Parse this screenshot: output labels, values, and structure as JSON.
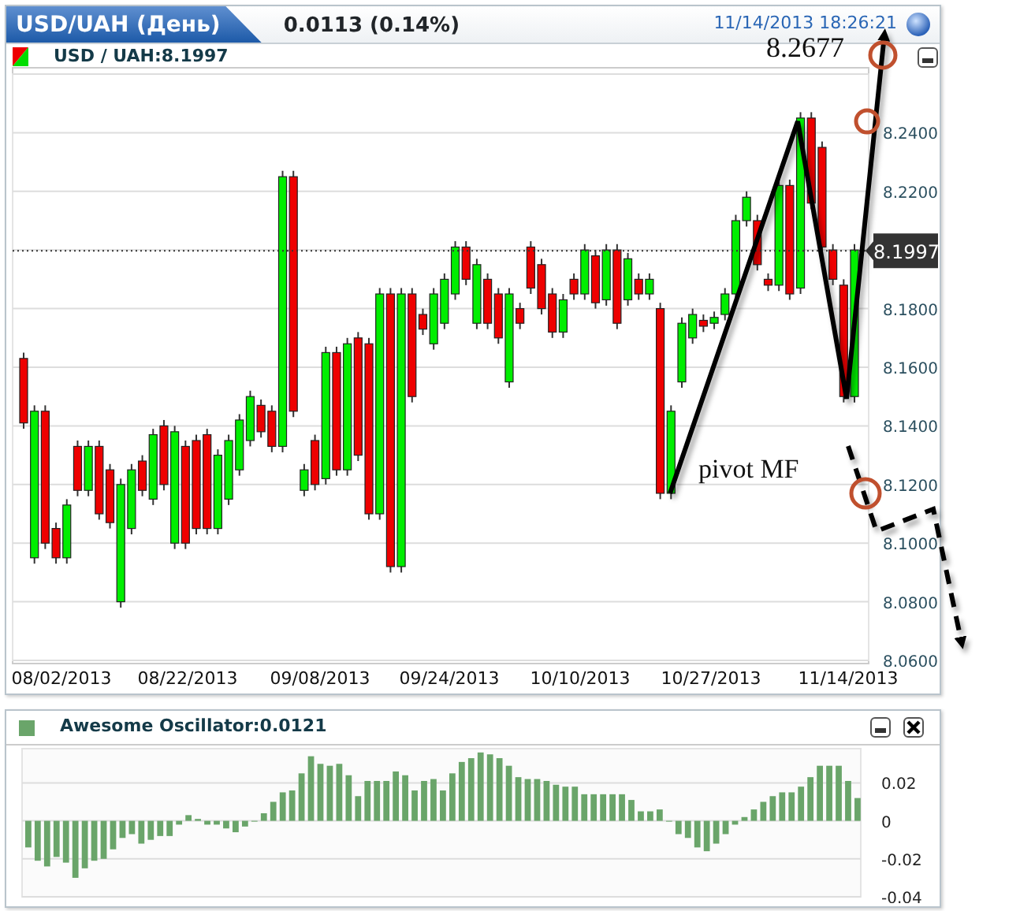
{
  "header": {
    "title": "USD/UAH (День)",
    "change": "0.0113 (0.14%)",
    "timestamp": "11/14/2013 18:26:21"
  },
  "main_chart": {
    "legend": "USD / UAH:8.1997",
    "x_axis_labels": [
      "08/02/2013",
      "08/22/2013",
      "09/08/2013",
      "09/24/2013",
      "10/10/2013",
      "10/27/2013",
      "11/14/2013"
    ],
    "chart_data": {
      "type": "candlestick",
      "ylim": [
        8.06,
        8.26
      ],
      "grid": true,
      "ref_lines": [
        {
          "axis": "y",
          "value": 8.1997,
          "label": "8.1997"
        }
      ],
      "yticks": [
        {
          "value": 8.24,
          "label": "8.2400"
        },
        {
          "value": 8.22,
          "label": "8.2200"
        },
        {
          "value": 8.18,
          "label": "8.1800"
        },
        {
          "value": 8.16,
          "label": "8.1600"
        },
        {
          "value": 8.14,
          "label": "8.1400"
        },
        {
          "value": 8.12,
          "label": "8.1200"
        },
        {
          "value": 8.1,
          "label": "8.1000"
        },
        {
          "value": 8.08,
          "label": "8.0800"
        },
        {
          "value": 8.06,
          "label": "8.0600"
        }
      ],
      "ohlc": [
        [
          8.163,
          8.165,
          8.139,
          8.141
        ],
        [
          8.095,
          8.147,
          8.093,
          8.145
        ],
        [
          8.145,
          8.147,
          8.098,
          8.1
        ],
        [
          8.105,
          8.107,
          8.093,
          8.095
        ],
        [
          8.095,
          8.115,
          8.093,
          8.113
        ],
        [
          8.133,
          8.135,
          8.116,
          8.118
        ],
        [
          8.118,
          8.135,
          8.116,
          8.133
        ],
        [
          8.133,
          8.135,
          8.108,
          8.11
        ],
        [
          8.125,
          8.127,
          8.105,
          8.107
        ],
        [
          8.08,
          8.122,
          8.078,
          8.12
        ],
        [
          8.105,
          8.127,
          8.103,
          8.125
        ],
        [
          8.128,
          8.13,
          8.116,
          8.118
        ],
        [
          8.115,
          8.139,
          8.113,
          8.137
        ],
        [
          8.14,
          8.142,
          8.118,
          8.12
        ],
        [
          8.1,
          8.14,
          8.098,
          8.138
        ],
        [
          8.133,
          8.135,
          8.098,
          8.1
        ],
        [
          8.135,
          8.137,
          8.103,
          8.105
        ],
        [
          8.137,
          8.139,
          8.103,
          8.105
        ],
        [
          8.105,
          8.132,
          8.103,
          8.13
        ],
        [
          8.115,
          8.137,
          8.113,
          8.135
        ],
        [
          8.125,
          8.144,
          8.123,
          8.142
        ],
        [
          8.135,
          8.152,
          8.133,
          8.15
        ],
        [
          8.147,
          8.149,
          8.136,
          8.138
        ],
        [
          8.145,
          8.147,
          8.131,
          8.133
        ],
        [
          8.133,
          8.227,
          8.131,
          8.225
        ],
        [
          8.225,
          8.227,
          8.143,
          8.145
        ],
        [
          8.118,
          8.127,
          8.116,
          8.125
        ],
        [
          8.135,
          8.137,
          8.118,
          8.12
        ],
        [
          8.122,
          8.167,
          8.12,
          8.165
        ],
        [
          8.165,
          8.167,
          8.123,
          8.125
        ],
        [
          8.125,
          8.17,
          8.123,
          8.168
        ],
        [
          8.17,
          8.172,
          8.128,
          8.13
        ],
        [
          8.168,
          8.17,
          8.108,
          8.11
        ],
        [
          8.11,
          8.187,
          8.108,
          8.185
        ],
        [
          8.185,
          8.187,
          8.09,
          8.092
        ],
        [
          8.092,
          8.187,
          8.09,
          8.185
        ],
        [
          8.185,
          8.187,
          8.148,
          8.15
        ],
        [
          8.178,
          8.18,
          8.171,
          8.173
        ],
        [
          8.168,
          8.187,
          8.166,
          8.185
        ],
        [
          8.175,
          8.192,
          8.173,
          8.19
        ],
        [
          8.185,
          8.203,
          8.183,
          8.201
        ],
        [
          8.201,
          8.203,
          8.188,
          8.19
        ],
        [
          8.175,
          8.197,
          8.173,
          8.195
        ],
        [
          8.19,
          8.192,
          8.173,
          8.175
        ],
        [
          8.185,
          8.187,
          8.168,
          8.17
        ],
        [
          8.155,
          8.187,
          8.153,
          8.185
        ],
        [
          8.18,
          8.182,
          8.173,
          8.175
        ],
        [
          8.201,
          8.203,
          8.185,
          8.187
        ],
        [
          8.195,
          8.197,
          8.178,
          8.18
        ],
        [
          8.185,
          8.187,
          8.17,
          8.172
        ],
        [
          8.172,
          8.185,
          8.17,
          8.183
        ],
        [
          8.19,
          8.192,
          8.183,
          8.185
        ],
        [
          8.185,
          8.202,
          8.183,
          8.2
        ],
        [
          8.198,
          8.2,
          8.18,
          8.182
        ],
        [
          8.183,
          8.202,
          8.181,
          8.2
        ],
        [
          8.2,
          8.202,
          8.173,
          8.175
        ],
        [
          8.183,
          8.199,
          8.181,
          8.197
        ],
        [
          8.19,
          8.192,
          8.183,
          8.185
        ],
        [
          8.185,
          8.192,
          8.183,
          8.19
        ],
        [
          8.18,
          8.182,
          8.115,
          8.117
        ],
        [
          8.117,
          8.147,
          8.115,
          8.145
        ],
        [
          8.155,
          8.177,
          8.153,
          8.175
        ],
        [
          8.17,
          8.18,
          8.168,
          8.178
        ],
        [
          8.176,
          8.178,
          8.172,
          8.174
        ],
        [
          8.175,
          8.179,
          8.173,
          8.177
        ],
        [
          8.178,
          8.187,
          8.176,
          8.185
        ],
        [
          8.185,
          8.212,
          8.183,
          8.21
        ],
        [
          8.21,
          8.22,
          8.208,
          8.218
        ],
        [
          8.21,
          8.212,
          8.193,
          8.195
        ],
        [
          8.19,
          8.192,
          8.186,
          8.188
        ],
        [
          8.188,
          8.224,
          8.186,
          8.222
        ],
        [
          8.222,
          8.224,
          8.183,
          8.185
        ],
        [
          8.187,
          8.247,
          8.185,
          8.245
        ],
        [
          8.245,
          8.247,
          8.214,
          8.216
        ],
        [
          8.235,
          8.237,
          8.199,
          8.201
        ],
        [
          8.2,
          8.202,
          8.188,
          8.19
        ],
        [
          8.188,
          8.19,
          8.148,
          8.15
        ],
        [
          8.15,
          8.202,
          8.148,
          8.2
        ]
      ]
    }
  },
  "annotations": {
    "target_label": "8.2677",
    "pivot_label": "pivot MF"
  },
  "oscillator": {
    "title": "Awesome Oscillator:0.0121",
    "chart_data": {
      "type": "bar",
      "grid": true,
      "ylim": [
        -0.04,
        0.038
      ],
      "yticks": [
        0.02,
        0,
        -0.02,
        -0.04
      ],
      "values": [
        -0.014,
        -0.021,
        -0.024,
        -0.019,
        -0.022,
        -0.03,
        -0.025,
        -0.021,
        -0.02,
        -0.015,
        -0.009,
        -0.007,
        -0.012,
        -0.01,
        -0.008,
        -0.008,
        -0.002,
        0.003,
        0.001,
        -0.002,
        -0.002,
        -0.004,
        -0.006,
        -0.003,
        0,
        0.004,
        0.01,
        0.015,
        0.016,
        0.025,
        0.034,
        0.03,
        0.029,
        0.03,
        0.024,
        0.013,
        0.021,
        0.021,
        0.021,
        0.026,
        0.024,
        0.016,
        0.021,
        0.022,
        0.016,
        0.025,
        0.031,
        0.033,
        0.036,
        0.035,
        0.033,
        0.029,
        0.023,
        0.022,
        0.022,
        0.021,
        0.019,
        0.018,
        0.018,
        0.014,
        0.014,
        0.014,
        0.014,
        0.014,
        0.011,
        0.005,
        0.005,
        0.006,
        0,
        -0.007,
        -0.009,
        -0.014,
        -0.016,
        -0.012,
        -0.007,
        -0.002,
        0.002,
        0.006,
        0.01,
        0.013,
        0.015,
        0.015,
        0.018,
        0.023,
        0.029,
        0.029,
        0.029,
        0.021,
        0.012
      ]
    }
  }
}
